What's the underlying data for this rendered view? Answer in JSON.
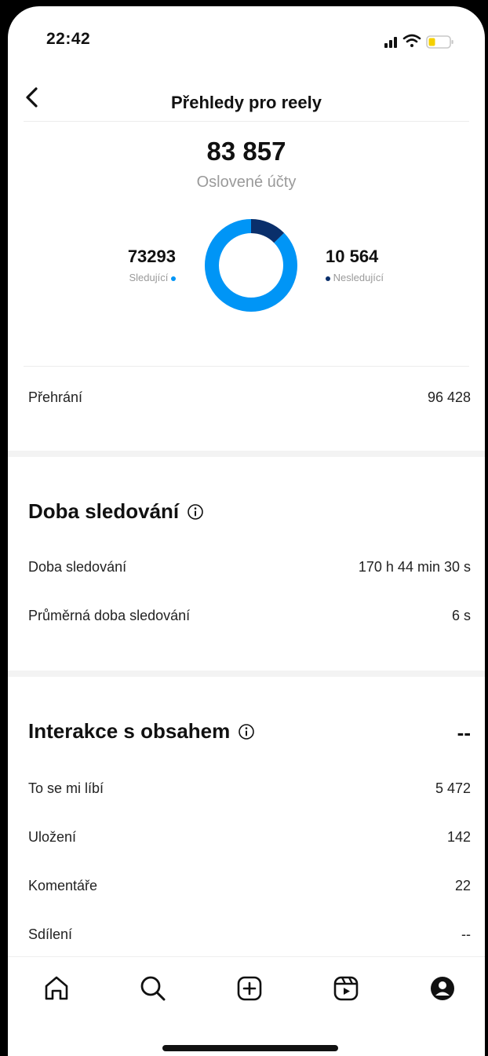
{
  "status_bar": {
    "time": "22:42"
  },
  "header": {
    "title": "Přehledy pro reely"
  },
  "reach": {
    "total": "83 857",
    "total_label": "Oslovené účty",
    "followers_value": "73293",
    "followers_label": "Sledující",
    "non_followers_value": "10 564",
    "non_followers_label": "Nesledující",
    "followers_fraction": 0.874,
    "followers_color": "#0095f6",
    "non_followers_color": "#0a2f6b"
  },
  "plays": {
    "label": "Přehrání",
    "value": "96 428"
  },
  "watch_time": {
    "title": "Doba sledování",
    "rows": [
      {
        "label": "Doba sledování",
        "value": "170 h 44 min 30 s"
      },
      {
        "label": "Průměrná doba sledování",
        "value": "6 s"
      }
    ]
  },
  "interactions": {
    "title": "Interakce s obsahem",
    "total": "--",
    "rows": [
      {
        "label": "To se mi líbí",
        "value": "5 472"
      },
      {
        "label": "Uložení",
        "value": "142"
      },
      {
        "label": "Komentáře",
        "value": "22"
      },
      {
        "label": "Sdílení",
        "value": "--"
      }
    ]
  },
  "tabbar": {
    "icons": [
      "home-icon",
      "search-icon",
      "create-icon",
      "reels-icon",
      "profile-icon"
    ]
  }
}
